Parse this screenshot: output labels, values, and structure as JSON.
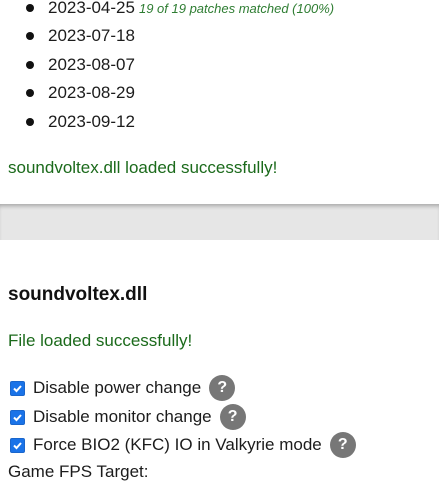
{
  "patch_dates": [
    {
      "date": "2023-04-25",
      "note": "19 of 19 patches matched (100%)"
    },
    {
      "date": "2023-07-18"
    },
    {
      "date": "2023-08-07"
    },
    {
      "date": "2023-08-29"
    },
    {
      "date": "2023-09-12"
    }
  ],
  "top_status": "soundvoltex.dll loaded successfully!",
  "file_card": {
    "title": "soundvoltex.dll",
    "status": "File loaded successfully!",
    "options": [
      {
        "label": "Disable power change",
        "checked": true
      },
      {
        "label": "Disable monitor change",
        "checked": true
      },
      {
        "label": "Force BIO2 (KFC) IO in Valkyrie mode",
        "checked": true
      }
    ],
    "help_glyph": "?",
    "fps_label": "Game FPS Target:"
  },
  "colors": {
    "success": "#1b6a1b",
    "checkbox": "#1a73e8",
    "help_bg": "#777777",
    "gap": "#e6e6e6"
  }
}
